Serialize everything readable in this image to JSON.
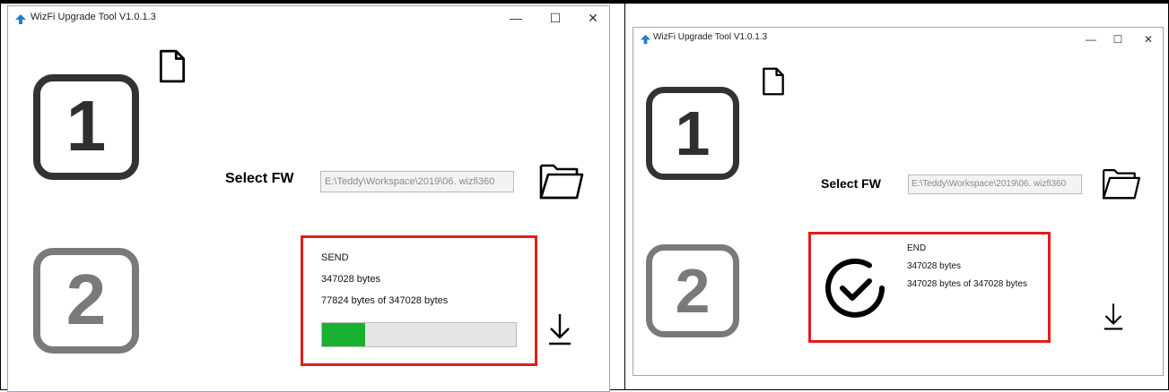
{
  "screens": [
    {
      "title": "WizFi Upgrade Tool V1.0.1.3",
      "step1_number": "1",
      "step2_number": "2",
      "select_label": "Select FW",
      "fw_path": "E:\\Teddy\\Workspace\\2019\\06. wizfi360",
      "status": "SEND",
      "size_text": "347028 bytes",
      "progress_text": "77824 bytes of 347028 bytes",
      "progress_fraction": 0.224,
      "progress_color": "#17b12f"
    },
    {
      "title": "WizFi Upgrade Tool V1.0.1.3",
      "step1_number": "1",
      "step2_number": "2",
      "select_label": "Select FW",
      "fw_path": "E:\\Teddy\\Workspace\\2019\\06. wizfi360",
      "status": "END",
      "size_text": "347028 bytes",
      "progress_text": "347028 bytes of 347028 bytes"
    }
  ],
  "window_controls": {
    "minimize": "—",
    "maximize": "☐",
    "close": "✕"
  },
  "icons": {
    "app": "wizfi-app-icon",
    "file": "file-icon",
    "folder": "folder-open-icon",
    "download": "download-arrow-icon",
    "check": "check-circle-icon"
  },
  "colors": {
    "highlight_border": "#e31c1c",
    "progress_fill": "#17b12f"
  }
}
